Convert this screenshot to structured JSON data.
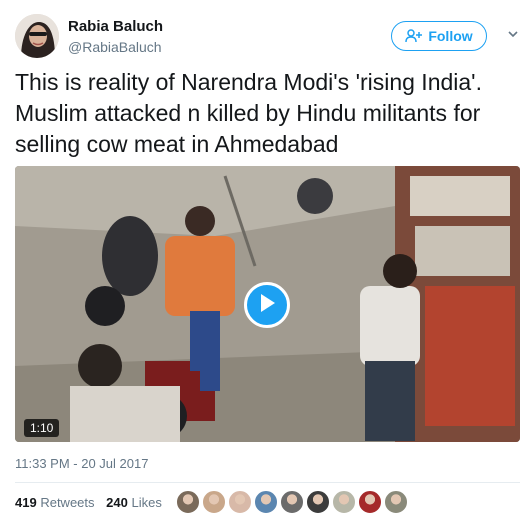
{
  "author": {
    "name": "Rabia Baluch",
    "handle": "@RabiaBaluch"
  },
  "follow_button": {
    "label": "Follow",
    "icon": "add-user-icon",
    "color": "#1da1f2"
  },
  "tweet": {
    "text": "This is reality of Narendra Modi's 'rising India'. Muslim attacked n killed by Hindu militants for selling cow meat in Ahmedabad"
  },
  "media": {
    "type": "video",
    "duration": "1:10",
    "icon": "play-icon"
  },
  "timestamp": "11:33 PM - 20 Jul 2017",
  "stats": {
    "retweets_count": "419",
    "retweets_label": "Retweets",
    "likes_count": "240",
    "likes_label": "Likes"
  },
  "liker_avatars": [
    {
      "color": "#7a6a5a"
    },
    {
      "color": "#c9a78a"
    },
    {
      "color": "#d8b9a8"
    },
    {
      "color": "#5b86b0"
    },
    {
      "color": "#6b6b6b"
    },
    {
      "color": "#3c3c3c"
    },
    {
      "color": "#b7b7a8"
    },
    {
      "color": "#a52a2a"
    },
    {
      "color": "#8a8a7a"
    }
  ]
}
